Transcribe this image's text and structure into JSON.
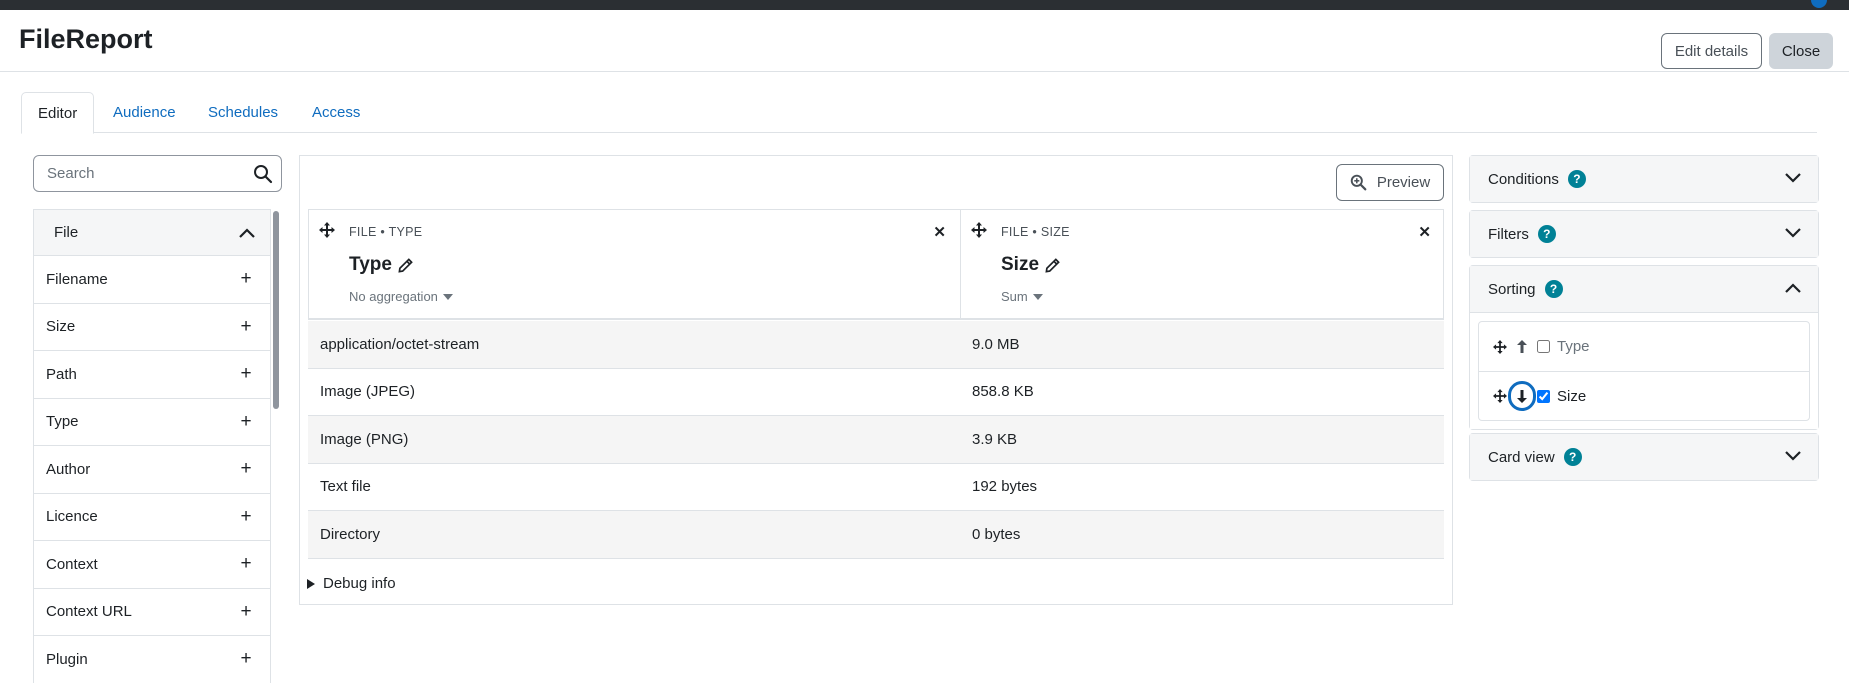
{
  "header": {
    "title": "FileReport",
    "edit_label": "Edit details",
    "close_label": "Close"
  },
  "tabs": [
    {
      "label": "Editor",
      "active": true
    },
    {
      "label": "Audience"
    },
    {
      "label": "Schedules"
    },
    {
      "label": "Access"
    }
  ],
  "sidebar": {
    "search_placeholder": "Search",
    "group": "File",
    "items": [
      "Filename",
      "Size",
      "Path",
      "Type",
      "Author",
      "Licence",
      "Context",
      "Context URL",
      "Plugin"
    ]
  },
  "report": {
    "preview_label": "Preview",
    "columns": [
      {
        "category": "FILE • TYPE",
        "name": "Type",
        "aggregation": "No aggregation"
      },
      {
        "category": "FILE • SIZE",
        "name": "Size",
        "aggregation": "Sum"
      }
    ],
    "rows": [
      [
        "application/octet-stream",
        "9.0 MB"
      ],
      [
        "Image (JPEG)",
        "858.8 KB"
      ],
      [
        "Image (PNG)",
        "3.9 KB"
      ],
      [
        "Text file",
        "192 bytes"
      ],
      [
        "Directory",
        "0 bytes"
      ]
    ],
    "debug_label": "Debug info"
  },
  "settings": {
    "conditions": "Conditions",
    "filters": "Filters",
    "sorting": "Sorting",
    "card_view": "Card view",
    "help_glyph": "?",
    "sort_items": [
      {
        "label": "Type",
        "checked": false,
        "direction": "up"
      },
      {
        "label": "Size",
        "checked": true,
        "direction": "down"
      }
    ]
  },
  "colors": {
    "link": "#0f6cbf",
    "help_badge": "#008196",
    "close_button": "#ced4da"
  },
  "icons": [
    "search-icon",
    "chevron-up-icon",
    "plus-icon",
    "move-icon",
    "close-icon",
    "pencil-icon",
    "caret-down-icon",
    "zoom-in-icon",
    "help-icon",
    "chevron-down-icon",
    "arrow-up-icon",
    "arrow-down-icon",
    "triangle-right-icon"
  ]
}
